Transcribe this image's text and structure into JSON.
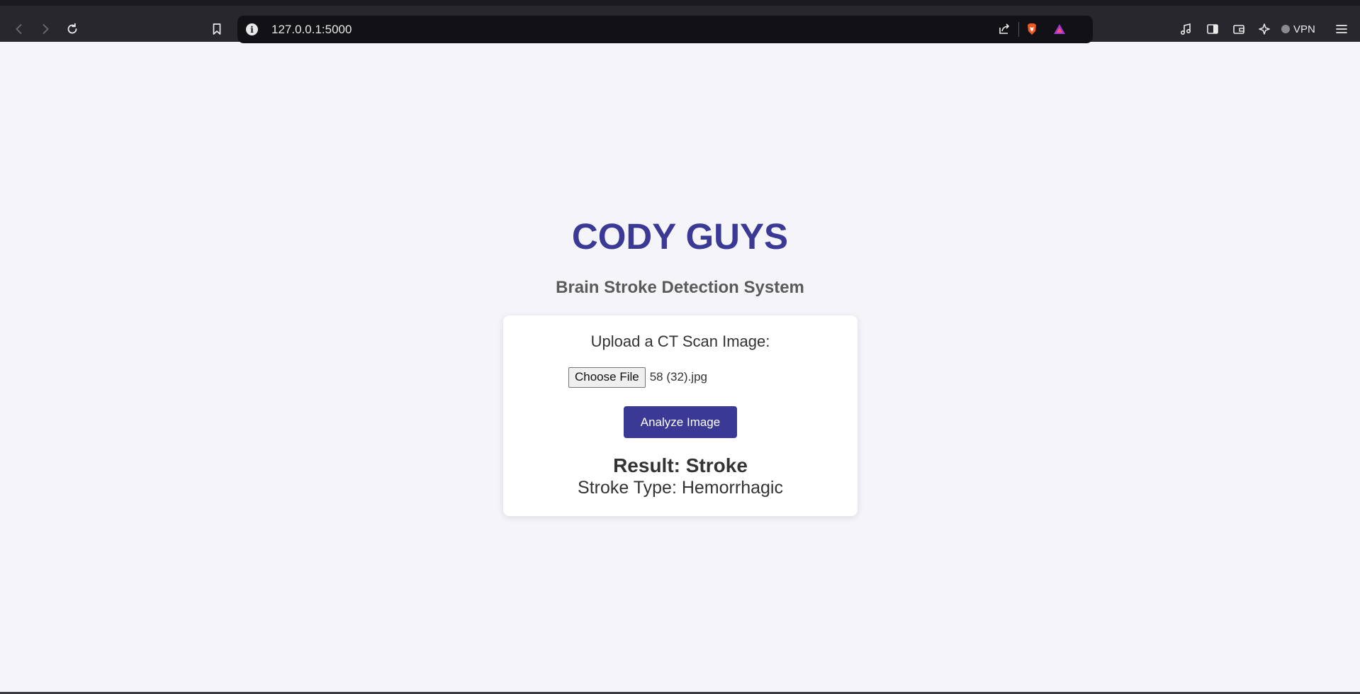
{
  "browser": {
    "url": "127.0.0.1:5000",
    "vpn_label": "VPN",
    "icons": [
      "back-icon",
      "forward-icon",
      "reload-icon",
      "bookmark-icon",
      "site-info-icon",
      "share-icon",
      "brave-shields-icon",
      "brave-rewards-icon",
      "media-icon",
      "sidebar-icon",
      "wallet-icon",
      "leo-ai-icon",
      "menu-icon"
    ]
  },
  "page": {
    "title": "CODY GUYS",
    "subtitle": "Brain Stroke Detection System",
    "upload_label": "Upload a CT Scan Image:",
    "choose_file_label": "Choose File",
    "file_name": "58 (32).jpg",
    "analyze_label": "Analyze Image",
    "result_text": "Result: Stroke",
    "stroke_type_text": "Stroke Type: Hemorrhagic"
  },
  "colors": {
    "accent": "#3a3a96",
    "background": "#f4f4f9",
    "chrome": "#28272d"
  }
}
